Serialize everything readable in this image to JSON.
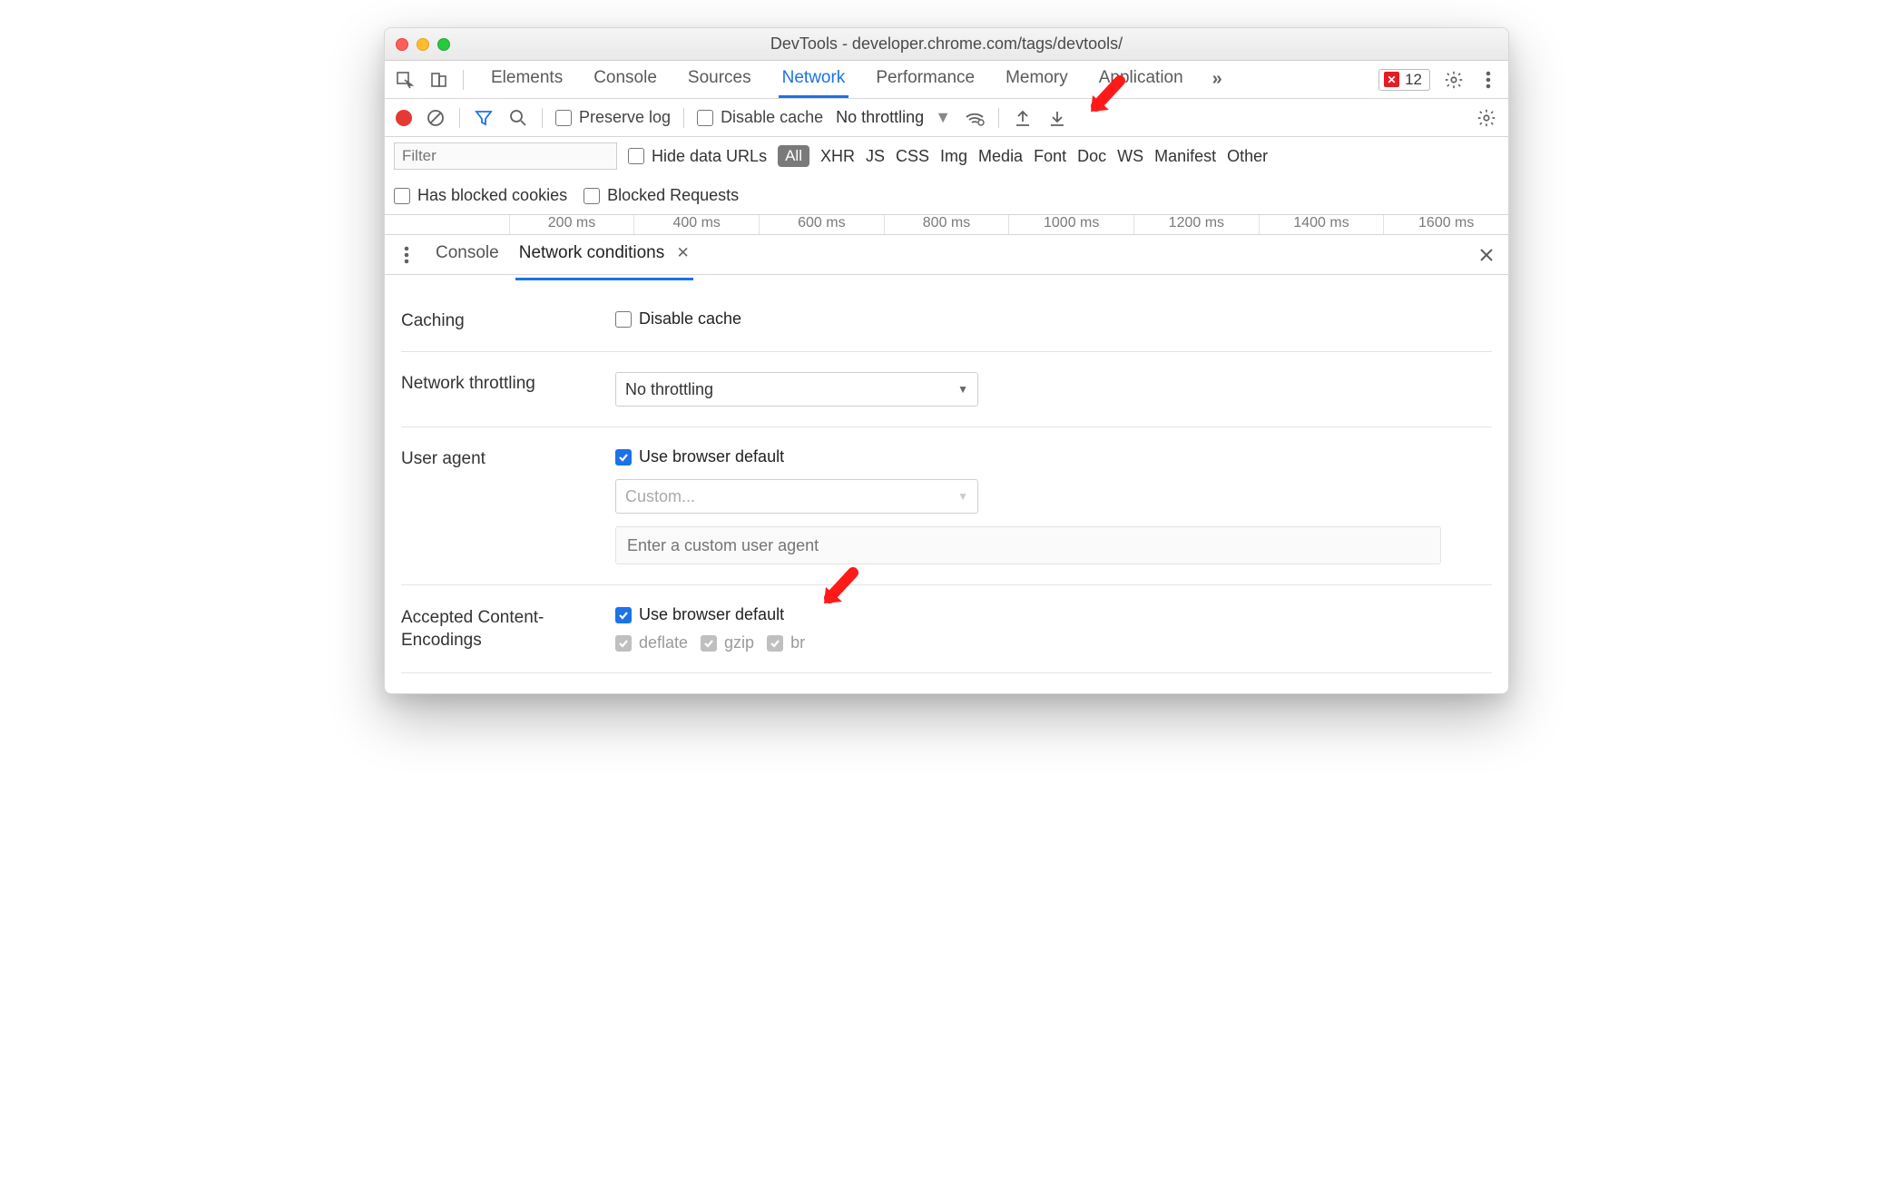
{
  "window": {
    "title": "DevTools - developer.chrome.com/tags/devtools/"
  },
  "main_tabs": {
    "items": [
      {
        "label": "Elements"
      },
      {
        "label": "Console"
      },
      {
        "label": "Sources"
      },
      {
        "label": "Network"
      },
      {
        "label": "Performance"
      },
      {
        "label": "Memory"
      },
      {
        "label": "Application"
      }
    ],
    "error_count": "12"
  },
  "net_toolbar": {
    "preserve_log": "Preserve log",
    "disable_cache": "Disable cache",
    "throttling": "No throttling"
  },
  "filter": {
    "placeholder": "Filter",
    "hide_data_urls": "Hide data URLs",
    "all": "All",
    "types": [
      "XHR",
      "JS",
      "CSS",
      "Img",
      "Media",
      "Font",
      "Doc",
      "WS",
      "Manifest",
      "Other"
    ],
    "has_blocked": "Has blocked cookies",
    "blocked_req": "Blocked Requests"
  },
  "timeline": {
    "ticks": [
      "200 ms",
      "400 ms",
      "600 ms",
      "800 ms",
      "1000 ms",
      "1200 ms",
      "1400 ms",
      "1600 ms"
    ]
  },
  "drawer": {
    "tabs": {
      "console": "Console",
      "network_conditions": "Network conditions"
    },
    "caching": {
      "label": "Caching",
      "disable_cache": "Disable cache"
    },
    "throttling": {
      "label": "Network throttling",
      "select": "No throttling"
    },
    "user_agent": {
      "label": "User agent",
      "use_default": "Use browser default",
      "custom_select": "Custom...",
      "custom_placeholder": "Enter a custom user agent"
    },
    "encodings": {
      "label": "Accepted Content-Encodings",
      "use_default": "Use browser default",
      "items": [
        "deflate",
        "gzip",
        "br"
      ]
    }
  }
}
